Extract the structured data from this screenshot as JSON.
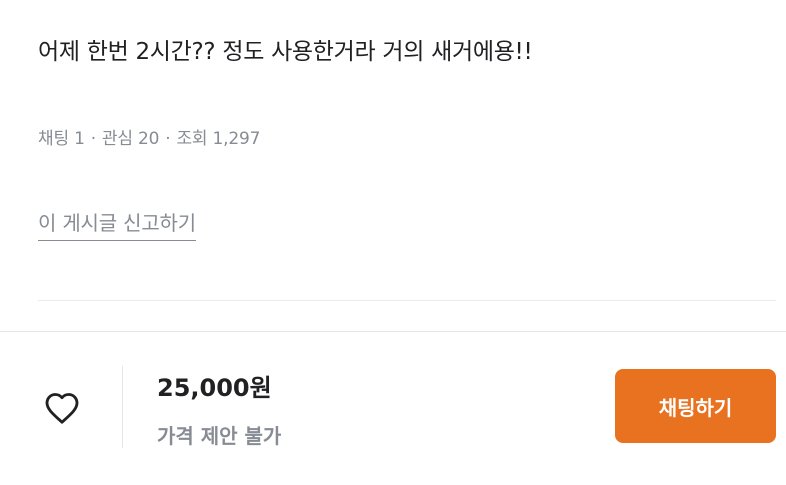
{
  "post": {
    "description": "어제 한번 2시간?? 정도 사용한거라 거의 새거에용!!",
    "stats": {
      "chats": "채팅 1",
      "interests": "관심 20",
      "views": "조회 1,297",
      "separator": "·"
    },
    "report_link": "이 게시글 신고하기"
  },
  "bottom_bar": {
    "like_icon": "heart-outline-icon",
    "price": "25,000원",
    "negotiation": "가격 제안 불가",
    "chat_button": "채팅하기",
    "accent_color": "#e8721f"
  }
}
